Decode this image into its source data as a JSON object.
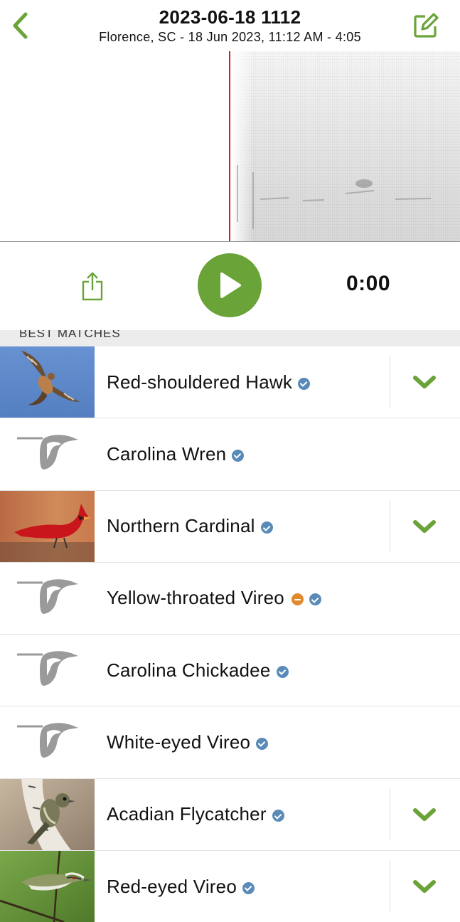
{
  "header": {
    "title": "2023-06-18 1112",
    "subtitle": "Florence, SC - 18 Jun 2023, 11:12 AM - 4:05",
    "back_icon": "chevron-left-icon",
    "edit_icon": "edit-note-icon"
  },
  "player": {
    "time": "0:00",
    "share_icon": "share-icon",
    "play_icon": "play-icon"
  },
  "colors": {
    "accent": "#6aa337",
    "verified_badge": "#5a8bb8",
    "rare_badge": "#e08a2c",
    "playhead": "#d11c1c"
  },
  "section": {
    "label": "BEST MATCHES"
  },
  "matches": [
    {
      "name": "Red-shouldered Hawk",
      "image": "photo",
      "rare": false,
      "confirmed": true
    },
    {
      "name": "Carolina Wren",
      "image": "placeholder",
      "rare": false,
      "confirmed": false
    },
    {
      "name": "Northern Cardinal",
      "image": "photo",
      "rare": false,
      "confirmed": true
    },
    {
      "name": "Yellow-throated Vireo",
      "image": "placeholder",
      "rare": true,
      "confirmed": false
    },
    {
      "name": "Carolina Chickadee",
      "image": "placeholder",
      "rare": false,
      "confirmed": false
    },
    {
      "name": "White-eyed Vireo",
      "image": "placeholder",
      "rare": false,
      "confirmed": false
    },
    {
      "name": "Acadian Flycatcher",
      "image": "photo",
      "rare": false,
      "confirmed": true
    },
    {
      "name": "Red-eyed Vireo",
      "image": "photo",
      "rare": false,
      "confirmed": true
    }
  ]
}
